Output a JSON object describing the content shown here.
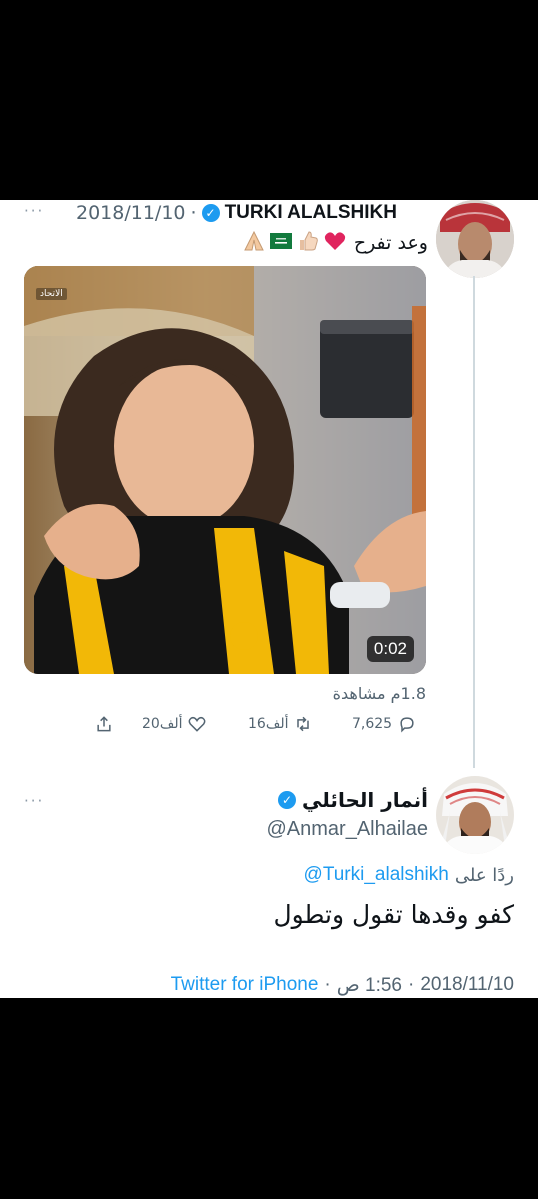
{
  "tweet1": {
    "date": "2018/11/10",
    "separator": "·",
    "author_name": "TURKI ALALSHIKH",
    "verified_mark": "✓",
    "text": "وعد تفرح",
    "emojis": [
      "heart-emoji",
      "thumbs-up-emoji",
      "saudi-flag-emoji",
      "praying-hands-emoji"
    ],
    "media": {
      "channel_tag": "الاتحاد",
      "duration": "0:02"
    },
    "views": "1.8م مشاهدة",
    "stats": {
      "replies": "7,625",
      "retweets": "16ألف",
      "likes": "20ألف"
    },
    "more": "···"
  },
  "tweet2": {
    "author_name": "أنمار الحائلي",
    "verified_mark": "✓",
    "handle": "@Anmar_Alhailae",
    "reply_prefix": "ردًا على",
    "reply_to": "@Turki_alalshikh",
    "text": "كفو وقدها تقول وتطول",
    "time": "1:56 ص",
    "date": "2018/11/10",
    "source": "Twitter for iPhone",
    "separator": "·",
    "more": "···"
  },
  "colors": {
    "link": "#1d9bf0",
    "muted": "#536471",
    "verified": "#1d9bf0",
    "heart": "#e0245e",
    "jersey_yellow": "#f2b807",
    "jersey_black": "#141414"
  }
}
